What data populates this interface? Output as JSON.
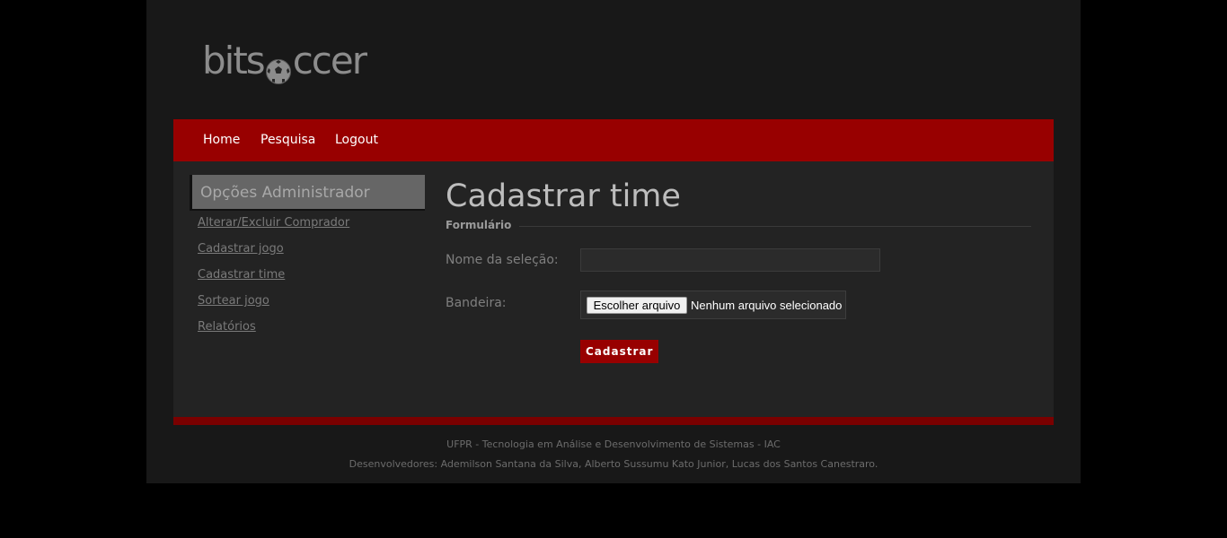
{
  "logo": {
    "text_before": "bits",
    "text_after": "ccer"
  },
  "nav": {
    "items": [
      "Home",
      "Pesquisa",
      "Logout"
    ]
  },
  "sidebar": {
    "title": "Opções Administrador",
    "links": [
      "Alterar/Excluir Comprador",
      "Cadastrar jogo",
      "Cadastrar time",
      "Sortear jogo",
      "Relatórios"
    ]
  },
  "main": {
    "title": "Cadastrar time",
    "legend": "Formulário",
    "fields": {
      "name_label": "Nome da seleção:",
      "name_value": "",
      "flag_label": "Bandeira:",
      "file_button": "Escolher arquivo",
      "file_status": "Nenhum arquivo selecionado"
    },
    "submit": "Cadastrar"
  },
  "footer": {
    "line1": "UFPR - Tecnologia em Análise e Desenvolvimento de Sistemas - IAC",
    "line2": "Desenvolvedores: Ademilson Santana da Silva, Alberto Sussumu Kato Junior, Lucas dos Santos Canestraro."
  },
  "colors": {
    "background": "#000000",
    "wrapper": "#181818",
    "content": "#232323",
    "accent": "#980000",
    "footer_bar": "#7a0000"
  },
  "icons": {
    "logo_ball": "soccer-ball-icon"
  }
}
